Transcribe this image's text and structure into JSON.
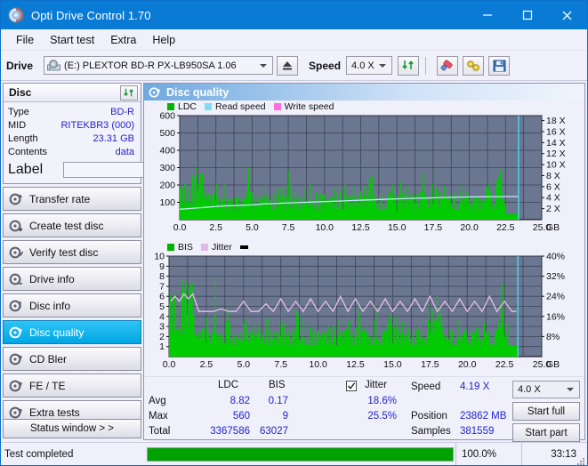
{
  "window": {
    "title": "Opti Drive Control 1.70",
    "icon": "disc-icon",
    "minimize": "─",
    "maximize": "□",
    "close": "✕"
  },
  "menu": [
    {
      "label": "File"
    },
    {
      "label": "Start test"
    },
    {
      "label": "Extra"
    },
    {
      "label": "Help"
    }
  ],
  "toolbar": {
    "drive_label": "Drive",
    "drive_value": "(E:)   PLEXTOR BD-R  PX-LB950SA 1.06",
    "eject_icon": "eject-icon",
    "speed_label": "Speed",
    "speed_value": "4.0 X",
    "refresh_icon": "refresh-icon",
    "eraser_icon": "eraser-icon",
    "tools_icon": "tools-icon",
    "save_icon": "save-icon"
  },
  "disc": {
    "panel_title": "Disc",
    "refresh_icon": "refresh-icon",
    "rows": [
      {
        "key": "Type",
        "value": "BD-R"
      },
      {
        "key": "MID",
        "value": "RITEKBR3 (000)"
      },
      {
        "key": "Length",
        "value": "23.31 GB"
      },
      {
        "key": "Contents",
        "value": "data"
      }
    ],
    "label_key": "Label",
    "label_value": "",
    "label_placeholder": "",
    "label_disc_icon": "disc-icon"
  },
  "sidebar": {
    "items": [
      {
        "label": "Transfer rate",
        "icon": "disc-test-icon",
        "active": false
      },
      {
        "label": "Create test disc",
        "icon": "disc-test-icon",
        "active": false
      },
      {
        "label": "Verify test disc",
        "icon": "disc-test-icon",
        "active": false
      },
      {
        "label": "Drive info",
        "icon": "disc-info-icon",
        "active": false
      },
      {
        "label": "Disc info",
        "icon": "disc-info-icon",
        "active": false
      },
      {
        "label": "Disc quality",
        "icon": "disc-quality-icon",
        "active": true
      },
      {
        "label": "CD Bler",
        "icon": "disc-test-icon",
        "active": false
      },
      {
        "label": "FE / TE",
        "icon": "disc-test-icon",
        "active": false
      },
      {
        "label": "Extra tests",
        "icon": "disc-test-icon",
        "active": false
      }
    ],
    "status_window_button": "Status window > >"
  },
  "panel": {
    "header_title": "Disc quality",
    "header_icon": "disc-quality-icon"
  },
  "chart_data": [
    {
      "type": "bar",
      "title": "LDC",
      "legend": [
        {
          "label": "LDC",
          "color": "#00b400"
        },
        {
          "label": "Read speed",
          "color": "#7fdcf5"
        },
        {
          "label": "Write speed",
          "color": "#ff6ee0"
        }
      ],
      "legend_position": "top-left",
      "xlabel": "GB",
      "ylabel": "",
      "ylim": [
        0,
        600
      ],
      "yticks": [
        100,
        200,
        300,
        400,
        500,
        600
      ],
      "xlim": [
        0,
        25.0
      ],
      "xticks": [
        "0.0",
        "2.5",
        "5.0",
        "7.5",
        "10.0",
        "12.5",
        "15.0",
        "17.5",
        "20.0",
        "22.5",
        "25.0"
      ],
      "y2label": "X",
      "y2lim": [
        0,
        19
      ],
      "y2ticks": [
        "2 X",
        "4 X",
        "6 X",
        "8 X",
        "10 X",
        "12 X",
        "14 X",
        "16 X",
        "18 X"
      ],
      "grid": true,
      "plot_bg": "#6b7691",
      "data_end_gb": 23.4,
      "series": [
        {
          "name": "LDC",
          "kind": "bar",
          "color": "#00cc00",
          "x": [
            0.1,
            0.3,
            0.5,
            0.7,
            0.9,
            1.1,
            1.3,
            1.5,
            1.7,
            1.9,
            2.1,
            2.3,
            2.5,
            2.7,
            2.9,
            3.1,
            3.3,
            3.5,
            3.7,
            3.9,
            4.1,
            4.3,
            4.5,
            4.7,
            4.9,
            5.1,
            5.3,
            5.5,
            5.7,
            5.9,
            6.1,
            6.3,
            6.5,
            6.7,
            6.9,
            7.1,
            7.3,
            7.5,
            7.7,
            7.9,
            8.1,
            8.3,
            8.5,
            8.7,
            8.9,
            9.1,
            9.3,
            9.5,
            9.7,
            9.9,
            10.1,
            10.3,
            10.5,
            10.7,
            10.9,
            11.1,
            11.3,
            11.5,
            11.7,
            11.9,
            12.1,
            12.3,
            12.5,
            12.7,
            12.9,
            13.1,
            13.3,
            13.5,
            13.7,
            13.9,
            14.1,
            14.3,
            14.5,
            14.7,
            14.9,
            15.1,
            15.3,
            15.5,
            15.7,
            15.9,
            16.1,
            16.3,
            16.5,
            16.7,
            16.9,
            17.1,
            17.3,
            17.5,
            17.7,
            17.9,
            18.1,
            18.3,
            18.5,
            18.7,
            18.9,
            19.1,
            19.3,
            19.5,
            19.7,
            19.9,
            20.1,
            20.3,
            20.5,
            20.7,
            20.9,
            21.1,
            21.3,
            21.5,
            21.7,
            21.9,
            22.1,
            22.3,
            22.5,
            22.7,
            22.9,
            23.1,
            23.3
          ],
          "values": [
            210,
            225,
            240,
            255,
            265,
            250,
            270,
            280,
            170,
            160,
            155,
            150,
            160,
            150,
            145,
            155,
            150,
            160,
            145,
            155,
            165,
            150,
            160,
            350,
            175,
            160,
            150,
            145,
            155,
            160,
            150,
            155,
            170,
            160,
            255,
            175,
            165,
            290,
            180,
            165,
            155,
            160,
            150,
            165,
            155,
            160,
            150,
            155,
            160,
            150,
            145,
            150,
            155,
            150,
            160,
            150,
            155,
            160,
            150,
            155,
            160,
            150,
            165,
            155,
            160,
            270,
            310,
            170,
            165,
            160,
            155,
            165,
            150,
            160,
            155,
            150,
            165,
            155,
            160,
            170,
            155,
            160,
            170,
            165,
            275,
            165,
            160,
            170,
            250,
            175,
            165,
            160,
            170,
            160,
            165,
            155,
            165,
            160,
            170,
            160,
            165,
            155,
            165,
            160,
            170,
            160,
            250,
            170,
            165,
            300,
            380,
            175,
            165
          ]
        },
        {
          "name": "Read speed",
          "kind": "line",
          "color": "#bfe9f8",
          "axis": "right",
          "x": [
            0.0,
            1.0,
            2.0,
            3.0,
            4.0,
            5.0,
            6.0,
            7.0,
            8.0,
            9.0,
            10.0,
            11.0,
            12.0,
            13.0,
            14.0,
            15.0,
            16.0,
            17.0,
            18.0,
            19.0,
            20.0,
            21.0,
            22.0,
            23.0,
            23.4
          ],
          "values": [
            1.9,
            2.1,
            2.3,
            2.5,
            2.6,
            2.7,
            2.9,
            3.0,
            3.1,
            3.2,
            3.3,
            3.4,
            3.5,
            3.6,
            3.7,
            3.8,
            3.9,
            3.95,
            4.05,
            4.1,
            4.15,
            4.18,
            4.2,
            4.22,
            4.22
          ]
        }
      ]
    },
    {
      "type": "bar",
      "title": "BIS",
      "legend": [
        {
          "label": "BIS",
          "color": "#00b400"
        },
        {
          "label": "Jitter",
          "color": "#e3b9ea"
        }
      ],
      "legend_position": "top-left",
      "xlabel": "GB",
      "ylabel": "",
      "ylim": [
        0,
        10
      ],
      "yticks": [
        1,
        2,
        3,
        4,
        5,
        6,
        7,
        8,
        9,
        10
      ],
      "xlim": [
        0,
        25.0
      ],
      "xticks": [
        "0.0",
        "2.5",
        "5.0",
        "7.5",
        "10.0",
        "12.5",
        "15.0",
        "17.5",
        "20.0",
        "22.5",
        "25.0"
      ],
      "y2label": "%",
      "y2lim": [
        0,
        40
      ],
      "y2ticks": [
        "8%",
        "16%",
        "24%",
        "32%",
        "40%"
      ],
      "grid": true,
      "plot_bg": "#6b7691",
      "data_end_gb": 23.4,
      "series": [
        {
          "name": "BIS",
          "kind": "bar",
          "color": "#00cc00",
          "x": [
            0.1,
            0.3,
            0.5,
            0.7,
            0.9,
            1.1,
            1.3,
            1.5,
            1.7,
            1.9,
            2.1,
            2.3,
            2.5,
            2.7,
            2.9,
            3.1,
            3.3,
            3.5,
            3.7,
            3.9,
            4.1,
            4.3,
            4.5,
            4.7,
            4.9,
            5.1,
            5.3,
            5.5,
            5.7,
            5.9,
            6.1,
            6.3,
            6.5,
            6.7,
            6.9,
            7.1,
            7.3,
            7.5,
            7.7,
            7.9,
            8.1,
            8.3,
            8.5,
            8.7,
            8.9,
            9.1,
            9.3,
            9.5,
            9.7,
            9.9,
            10.1,
            10.3,
            10.5,
            10.7,
            10.9,
            11.1,
            11.3,
            11.5,
            11.7,
            11.9,
            12.1,
            12.3,
            12.5,
            12.7,
            12.9,
            13.1,
            13.3,
            13.5,
            13.7,
            13.9,
            14.1,
            14.3,
            14.5,
            14.7,
            14.9,
            15.1,
            15.3,
            15.5,
            15.7,
            15.9,
            16.1,
            16.3,
            16.5,
            16.7,
            16.9,
            17.1,
            17.3,
            17.5,
            17.7,
            17.9,
            18.1,
            18.3,
            18.5,
            18.7,
            18.9,
            19.1,
            19.3,
            19.5,
            19.7,
            19.9,
            20.1,
            20.3,
            20.5,
            20.7,
            20.9,
            21.1,
            21.3,
            21.5,
            21.7,
            21.9,
            22.1,
            22.3,
            22.5,
            22.7,
            22.9,
            23.1,
            23.3
          ],
          "values": [
            6.5,
            7,
            6,
            6.5,
            8,
            6,
            7,
            8,
            3,
            2.5,
            3,
            2.8,
            3,
            2.5,
            3,
            6,
            2.8,
            3,
            2.5,
            5.5,
            3,
            2.8,
            3,
            2.5,
            3,
            5.5,
            2.8,
            3,
            2.5,
            3,
            2.8,
            3,
            4.5,
            2.8,
            3,
            2.5,
            3,
            4.5,
            2.8,
            3,
            2.5,
            3,
            4.5,
            2.8,
            3,
            2.5,
            3,
            2.8,
            3,
            2.5,
            3,
            2.8,
            3,
            2.5,
            3,
            2.8,
            3,
            2.5,
            3,
            2.8,
            3,
            2.5,
            3,
            4.5,
            2.8,
            3,
            2.5,
            3,
            2.8,
            6,
            2.8,
            3,
            2.5,
            3,
            5,
            2.8,
            3,
            2.5,
            3,
            2.8,
            3,
            2.5,
            3,
            2.8,
            3,
            2.5,
            3,
            5,
            2.8,
            7,
            5.5,
            3,
            2.5,
            3,
            2.8,
            3,
            2.5,
            3,
            2.8,
            3,
            2.5,
            3,
            2.8,
            4.5,
            2.5,
            3,
            2.8,
            3,
            2.5,
            3,
            5,
            8,
            3,
            2.8
          ]
        },
        {
          "name": "Jitter",
          "kind": "line",
          "color": "#e6bfe9",
          "axis": "right",
          "x": [
            0.1,
            0.4,
            0.7,
            1.0,
            1.3,
            1.6,
            2.0,
            2.5,
            3.0,
            3.5,
            4.0,
            4.5,
            5.0,
            5.5,
            6.0,
            6.5,
            7.0,
            7.5,
            8.0,
            8.5,
            9.0,
            9.5,
            10.0,
            10.5,
            11.0,
            11.5,
            12.0,
            12.5,
            13.0,
            13.5,
            14.0,
            14.5,
            15.0,
            15.5,
            16.0,
            16.5,
            17.0,
            17.5,
            18.0,
            18.5,
            19.0,
            19.5,
            20.0,
            20.5,
            21.0,
            21.5,
            22.0,
            22.5,
            23.0,
            23.3
          ],
          "values": [
            22,
            24,
            22,
            25,
            23,
            25,
            18,
            18,
            18,
            19,
            18,
            18,
            22,
            18,
            18,
            21,
            18,
            23,
            18,
            22,
            18,
            23,
            18,
            22,
            18,
            24,
            18,
            23,
            18,
            22,
            18,
            23,
            18,
            22,
            18,
            23,
            18,
            24,
            18,
            22,
            18,
            23,
            18,
            22,
            18,
            24,
            18,
            22,
            18,
            18
          ]
        }
      ]
    }
  ],
  "stats": {
    "col_ldc": "LDC",
    "col_bis": "BIS",
    "jitter_label": "Jitter",
    "jitter_checked": true,
    "rows": [
      {
        "key": "Avg",
        "ldc": "8.82",
        "bis": "0.17",
        "jitter": "18.6%"
      },
      {
        "key": "Max",
        "ldc": "560",
        "bis": "9",
        "jitter": "25.5%"
      },
      {
        "key": "Total",
        "ldc": "3367586",
        "bis": "63027",
        "jitter": ""
      }
    ],
    "speed_key": "Speed",
    "speed_value": "4.19 X",
    "position_key": "Position",
    "position_value": "23862 MB",
    "samples_key": "Samples",
    "samples_value": "381559",
    "speed_select_value": "4.0 X",
    "start_full": "Start full",
    "start_part": "Start part"
  },
  "statusbar": {
    "text": "Test completed",
    "percent_value": 100,
    "percent_label": "100.0%",
    "elapsed": "33:13"
  }
}
